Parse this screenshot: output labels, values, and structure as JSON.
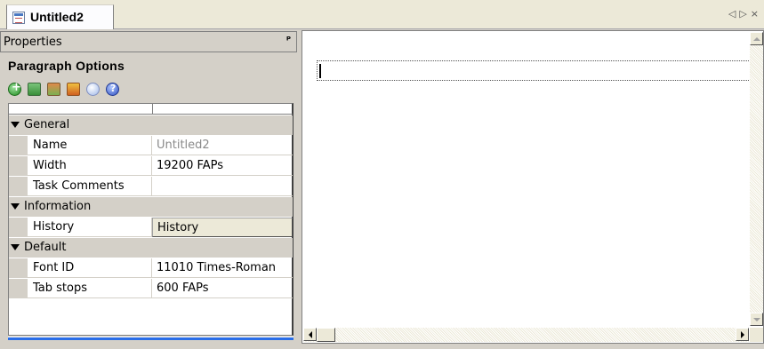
{
  "tab": {
    "title": "Untitled2",
    "icon": "document-icon",
    "nav_prev": "◁",
    "nav_next": "▷",
    "close": "×"
  },
  "properties": {
    "title": "Properties",
    "pin": "ᵖ",
    "section_title": "Paragraph Options",
    "toolbar": [
      {
        "icon": "add-icon"
      },
      {
        "icon": "move-down-icon"
      },
      {
        "icon": "move-up-icon"
      },
      {
        "icon": "warning-icon"
      },
      {
        "icon": "info-icon"
      },
      {
        "icon": "help-icon"
      }
    ],
    "categories": {
      "general": "General",
      "information": "Information",
      "default": "Default"
    },
    "rows": {
      "name": {
        "label": "Name",
        "value": "Untitled2"
      },
      "width": {
        "label": "Width",
        "value": "19200 FAPs"
      },
      "task_comments": {
        "label": "Task Comments",
        "value": ""
      },
      "history": {
        "label": "History",
        "value": "History"
      },
      "font_id": {
        "label": "Font ID",
        "value": "11010 Times-Roman"
      },
      "tab_stops": {
        "label": "Tab stops",
        "value": "600 FAPs"
      }
    }
  }
}
